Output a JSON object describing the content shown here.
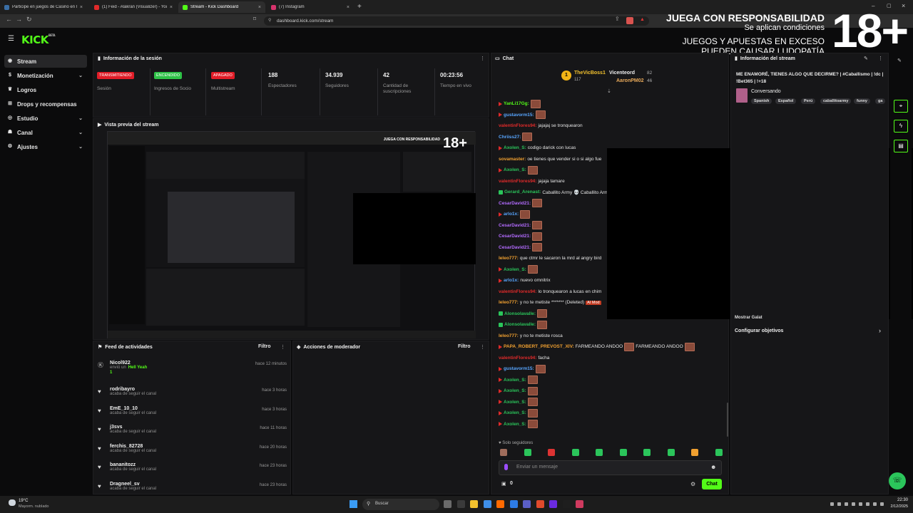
{
  "tabs": [
    {
      "label": "Participe en juegos de Casino en líne",
      "color": "#3a6ea5"
    },
    {
      "label": "(1) Feid - Alakran (Visualizer) - YouTub",
      "color": "#e02a2a"
    },
    {
      "label": "Stream - Kick Dashboard",
      "color": "#53fc18"
    },
    {
      "label": "(7) Instagram",
      "color": "#d6336c"
    }
  ],
  "url": "dashboard.kick.com/stream",
  "logo": "KICK",
  "logo_sup": "BETA",
  "sidebar": [
    {
      "label": "Stream",
      "icon": "broadcast-icon"
    },
    {
      "label": "Monetización",
      "icon": "dollar-icon",
      "chev": "⌄"
    },
    {
      "label": "Logros",
      "icon": "trophy-icon"
    },
    {
      "label": "Drops y recompensas",
      "icon": "gift-icon"
    },
    {
      "label": "Estudio",
      "icon": "studio-icon",
      "chev": "⌄"
    },
    {
      "label": "Canal",
      "icon": "user-icon",
      "chev": "⌄"
    },
    {
      "label": "Ajustes",
      "icon": "gear-icon",
      "chev": "⌄"
    }
  ],
  "session": {
    "title": "Información de la sesión",
    "badges": [
      {
        "text": "TRANSMITIENDO",
        "label": "Sesión",
        "bg": "#e11d28"
      },
      {
        "text": "ENCENDIDO",
        "label": "Ingresos de Socio",
        "bg": "#2ec247"
      },
      {
        "text": "APAGADO",
        "label": "Multistream",
        "bg": "#e11d28"
      }
    ],
    "stats": [
      {
        "value": "188",
        "label": "Espectadores"
      },
      {
        "value": "34.939",
        "label": "Seguidores"
      },
      {
        "value": "42",
        "label": "Cantidad de suscripciones"
      },
      {
        "value": "00:23:56",
        "label": "Tiempo en vivo"
      }
    ]
  },
  "preview": {
    "title": "Vista previa del stream"
  },
  "feed": {
    "title": "Feed de actividades",
    "filter": "Filtro",
    "items": [
      {
        "name": "Nicol922",
        "sub": "envió un",
        "extra": "Hell Yeah",
        "count": "1",
        "time": "hace 12 minutos",
        "icon": "kick-icon"
      },
      {
        "name": "rodribayro",
        "sub": "acaba de seguir el canal",
        "time": "hace 3 horas",
        "icon": "heart-icon"
      },
      {
        "name": "EmE_10_10",
        "sub": "acaba de seguir el canal",
        "time": "hace 3 horas",
        "icon": "heart-icon"
      },
      {
        "name": "j3svs",
        "sub": "acaba de seguir el canal",
        "time": "hace 11 horas",
        "icon": "heart-icon"
      },
      {
        "name": "ferchis_82728",
        "sub": "acaba de seguir el canal",
        "time": "hace 20 horas",
        "icon": "heart-icon"
      },
      {
        "name": "bananitozz",
        "sub": "acaba de seguir el canal",
        "time": "hace 23 horas",
        "icon": "heart-icon"
      },
      {
        "name": "Dragneel_sv",
        "sub": "acaba de seguir el canal",
        "time": "hace 23 horas",
        "icon": "heart-icon"
      }
    ]
  },
  "moderator": {
    "title": "Acciones de moderador",
    "filter": "Filtro"
  },
  "chat": {
    "title": "Chat",
    "top1": {
      "name": "TheVicBoss1",
      "count": "117"
    },
    "top2": {
      "name": "Vicenteord",
      "count": "82"
    },
    "top3": {
      "name": "AaronPM02",
      "count": "46"
    },
    "lines": [
      {
        "user": "YanLi17Gg:",
        "color": "#53fc18",
        "msg": "",
        "emote": true,
        "badge": "rb"
      },
      {
        "user": "gustavorm15:",
        "color": "#58a6ff",
        "msg": "",
        "emote": true,
        "badge": "rb"
      },
      {
        "user": "valentinFlores94:",
        "color": "#e02a2a",
        "msg": "jajajaj se tronquearon"
      },
      {
        "user": "Chriiss27:",
        "color": "#58a6ff",
        "msg": "",
        "emote": true
      },
      {
        "user": "Axolen_S:",
        "color": "#2bc55b",
        "msg": "codigo darick con lucas",
        "badge": "rb"
      },
      {
        "user": "sovamaster:",
        "color": "#f0a030",
        "msg": "oe tienes que vender si o si algo fue"
      },
      {
        "user": "Axolen_S:",
        "color": "#2bc55b",
        "msg": "",
        "emote": true,
        "badge": "rb"
      },
      {
        "user": "valentinFlores94:",
        "color": "#e02a2a",
        "msg": "jajaja tamare"
      },
      {
        "user": "Gerard_Arenast:",
        "color": "#2bc55b",
        "msg": "Caballito Army 💀 Caballito Army 💀 Caballito Army 💀 Caballito Arr",
        "badge": "gb"
      },
      {
        "user": "CesarDavid21:",
        "color": "#b36bff",
        "msg": "",
        "emote": true
      },
      {
        "user": "arlo1x:",
        "color": "#58a6ff",
        "msg": "",
        "emote": true,
        "badge": "rb"
      },
      {
        "user": "CesarDavid21:",
        "color": "#b36bff",
        "msg": "",
        "emote": true
      },
      {
        "user": "CesarDavid21:",
        "color": "#b36bff",
        "msg": "",
        "emote": true
      },
      {
        "user": "CesarDavid21:",
        "color": "#b36bff",
        "msg": "",
        "emote": true
      },
      {
        "user": "leleo777:",
        "color": "#f0a030",
        "msg": "que ctmr le sacaron la mrd al angry bird"
      },
      {
        "user": "Axolen_S:",
        "color": "#2bc55b",
        "msg": "",
        "emote": true,
        "badge": "rb"
      },
      {
        "user": "arlo1x:",
        "color": "#58a6ff",
        "msg": "nuevo omnitrix",
        "badge": "rb"
      },
      {
        "user": "valentinFlores94:",
        "color": "#e02a2a",
        "msg": "lo tronquearon a lucas en chim"
      },
      {
        "user": "leleo777:",
        "color": "#f0a030",
        "msg": "y no te metiste ******* (Deleted)",
        "tag": "AI Mod"
      },
      {
        "user": "Alonsolavalle:",
        "color": "#2bc55b",
        "msg": "",
        "emote": true,
        "badge": "gb"
      },
      {
        "user": "Alonsolavalle:",
        "color": "#2bc55b",
        "msg": "",
        "emote": true,
        "badge": "gb"
      },
      {
        "user": "leleo777:",
        "color": "#f0a030",
        "msg": "y no te metiste rosca"
      },
      {
        "user": "PAPA_ROBERT_PREVOST_XIV:",
        "color": "#f0a030",
        "msg": "FARMEANDO ANDOO",
        "badge": "rb",
        "tail": "FARMEANDO ANDOO"
      },
      {
        "user": "valentinFlores94:",
        "color": "#e02a2a",
        "msg": "facha"
      },
      {
        "user": "gustavorm15:",
        "color": "#58a6ff",
        "msg": "",
        "emote": true,
        "badge": "rb"
      },
      {
        "user": "Axolen_S:",
        "color": "#2bc55b",
        "msg": "",
        "emote": true,
        "badge": "rb"
      },
      {
        "user": "Axolen_S:",
        "color": "#2bc55b",
        "msg": "",
        "emote": true,
        "badge": "rb"
      },
      {
        "user": "Axolen_S:",
        "color": "#2bc55b",
        "msg": "",
        "emote": true,
        "badge": "rb"
      },
      {
        "user": "Axolen_S:",
        "color": "#2bc55b",
        "msg": "",
        "emote": true,
        "badge": "rb"
      },
      {
        "user": "Axolen_S:",
        "color": "#2bc55b",
        "msg": "",
        "emote": true,
        "badge": "rb"
      }
    ],
    "followers_only": "Solo seguidores",
    "placeholder": "Enviar un mensaje",
    "count": "0",
    "send": "Chat"
  },
  "stream_info": {
    "title": "Información del stream",
    "stream_title": "ME ENAMORÉ, TIENES ALGO QUE DECIRME? | #Caballismo | !dc | !Bet365 | !+18",
    "category": "Conversando",
    "tags": [
      "Spanish",
      "Español",
      "Perú",
      "caballitoarmy",
      "funny",
      "ga"
    ],
    "cfg_partial": "Mostrar Galat",
    "configure": "Configurar objetivos"
  },
  "overlay": {
    "line1": "JUEGA CON RESPONSABILIDAD",
    "line2": "Se aplican condiciones",
    "line3": "JUEGOS Y APUESTAS EN EXCESO",
    "line4": "PUEDEN CAUSAR LUDOPATÍA",
    "age": "18+"
  },
  "taskbar": {
    "weather_temp": "19°C",
    "weather_desc": "Mayorm. nublado",
    "search": "Buscar",
    "time": "22:30",
    "date": "2/12/2025"
  }
}
